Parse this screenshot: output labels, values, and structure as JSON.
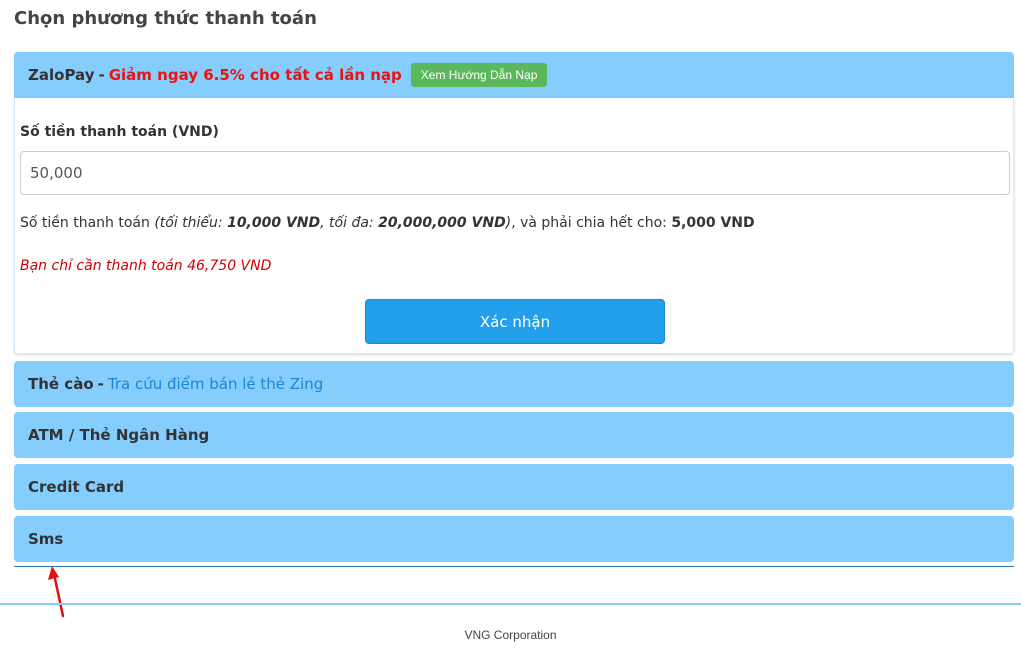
{
  "page": {
    "title": "Chọn phương thức thanh toán"
  },
  "zalopay": {
    "name": "ZaloPay",
    "separator": "-",
    "promo": "Giảm ngay 6.5% cho tất cả lần nạp",
    "guide_button": "Xem Hướng Dẫn Nạp",
    "amount_label": "Số tiền thanh toán (VND)",
    "amount_value": "50,000",
    "hint": {
      "prefix": "Số tiền thanh toán ",
      "paren_open": "(tối thiểu: ",
      "min": "10,000 VND",
      "max_label": ", tối đa: ",
      "max": "20,000,000 VND",
      "paren_close": ")",
      "divisible_text": ", và phải chia hết cho: ",
      "divisor": "5,000 VND"
    },
    "pay_notice": "Bạn chỉ cần thanh toán 46,750 VND",
    "confirm_button": "Xác nhận"
  },
  "the_cao": {
    "name": "Thẻ cào",
    "separator": "-",
    "link": "Tra cứu điểm bán lẻ thẻ Zing"
  },
  "atm": {
    "name": "ATM / Thẻ Ngân Hàng"
  },
  "credit_card": {
    "name": "Credit Card"
  },
  "sms": {
    "name": "Sms"
  },
  "footer": {
    "text": "VNG Corporation"
  },
  "colors": {
    "panel_header": "#84cdfd",
    "promo_red": "#ee1111",
    "guide_green": "#5cb85c",
    "confirm_blue": "#22a0ec",
    "link_blue": "#1b87d6",
    "notice_red": "#cc0000"
  }
}
